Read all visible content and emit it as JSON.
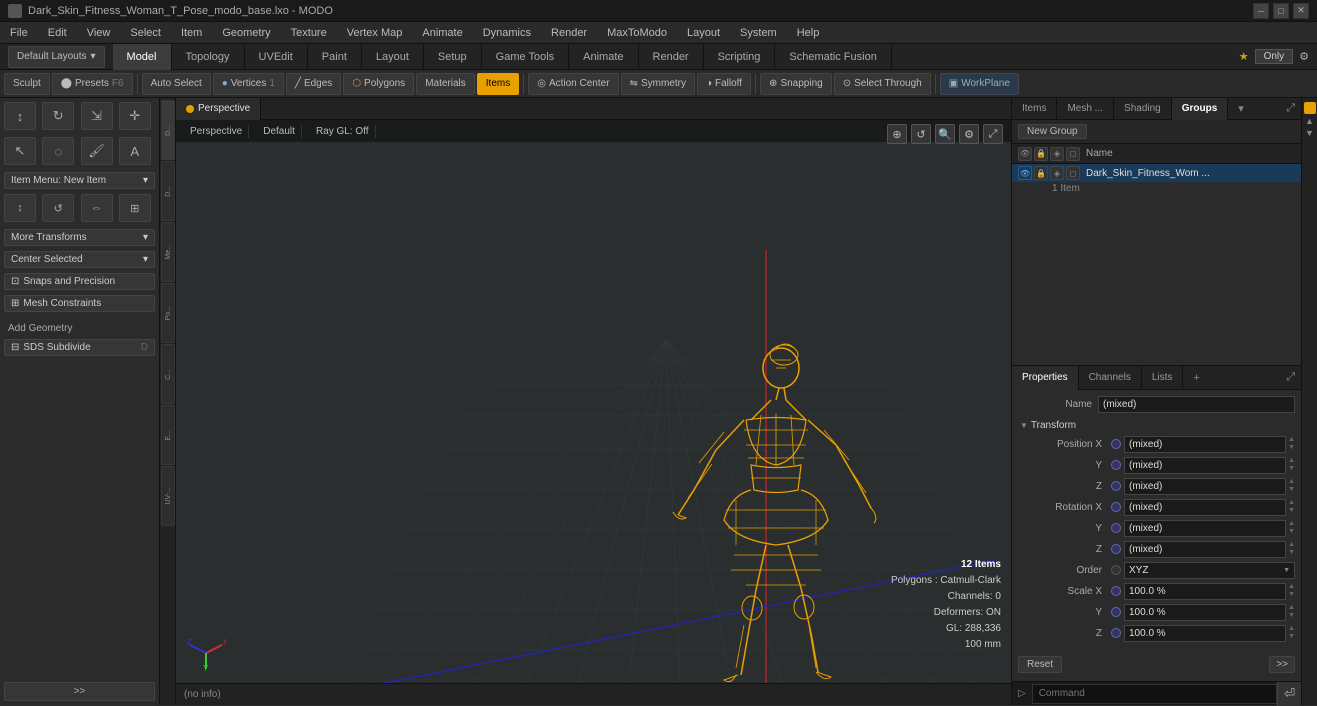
{
  "titlebar": {
    "title": "Dark_Skin_Fitness_Woman_T_Pose_modo_base.lxo - MODO",
    "controls": [
      "─",
      "□",
      "✕"
    ]
  },
  "menubar": {
    "items": [
      "File",
      "Edit",
      "View",
      "Select",
      "Item",
      "Geometry",
      "Texture",
      "Vertex Map",
      "Animate",
      "Dynamics",
      "Render",
      "MaxToModo",
      "Layout",
      "System",
      "Help"
    ]
  },
  "toolbar_row1": {
    "default_layout": "Default Layouts ▾"
  },
  "tabs": {
    "items": [
      "Model",
      "Topology",
      "UVEdit",
      "Paint",
      "Layout",
      "Setup",
      "Game Tools",
      "Animate",
      "Render",
      "Scripting",
      "Schematic Fusion"
    ],
    "active": "Model",
    "star_label": "★",
    "only_label": "Only",
    "add_label": "+"
  },
  "tools": {
    "auto_select": "Auto Select",
    "vertices": "Vertices",
    "edges": "Edges",
    "polygons": "Polygons",
    "materials": "Materials",
    "items": "Items",
    "action_center": "Action Center",
    "symmetry": "Symmetry",
    "falloff": "Falloff",
    "snapping": "Snapping",
    "select_through": "Select Through",
    "workplane": "WorkPlane"
  },
  "left_panel": {
    "sculpt_label": "Sculpt",
    "presets_label": "Presets",
    "presets_shortcut": "F6",
    "item_menu_label": "Item Menu: New Item",
    "more_transforms": "More Transforms",
    "center_selected": "Center Selected",
    "snaps_label": "Snaps and Precision",
    "mesh_constraints": "Mesh Constraints",
    "add_geometry": "Add Geometry",
    "sds_subdivide": "SDS Subdivide",
    "sds_shortcut": "D"
  },
  "viewport": {
    "view_type": "Perspective",
    "shader": "Default",
    "ray_gl": "Ray GL: Off"
  },
  "stats": {
    "items": "12 Items",
    "polygons": "Polygons : Catmull-Clark",
    "channels": "Channels: 0",
    "deformers": "Deformers: ON",
    "gl": "GL: 288,336",
    "size": "100 mm"
  },
  "status": {
    "info": "(no info)"
  },
  "right_panel": {
    "tabs": [
      "Items",
      "Mesh ...",
      "Shading",
      "Groups"
    ],
    "active_tab": "Groups",
    "new_group_btn": "New Group",
    "name_col": "Name",
    "group_item_name": "Dark_Skin_Fitness_Wom ...",
    "group_item_count": "1 Item"
  },
  "properties": {
    "tabs": [
      "Properties",
      "Channels",
      "Lists"
    ],
    "active_tab": "Properties",
    "add_label": "+",
    "name_label": "Name",
    "name_value": "(mixed)",
    "transform_section": "Transform",
    "position_x_label": "Position X",
    "position_x_value": "(mixed)",
    "position_y_label": "Y",
    "position_y_value": "(mixed)",
    "position_z_label": "Z",
    "position_z_value": "(mixed)",
    "rotation_x_label": "Rotation X",
    "rotation_x_value": "(mixed)",
    "rotation_y_label": "Y",
    "rotation_y_value": "(mixed)",
    "rotation_z_label": "Z",
    "rotation_z_value": "(mixed)",
    "order_label": "Order",
    "order_value": "XYZ",
    "scale_x_label": "Scale X",
    "scale_x_value": "100.0 %",
    "scale_y_label": "Y",
    "scale_y_value": "100.0 %",
    "scale_z_label": "Z",
    "scale_z_value": "100.0 %",
    "reset_btn": "Reset"
  },
  "command": {
    "label": "▷",
    "placeholder": "Command"
  }
}
